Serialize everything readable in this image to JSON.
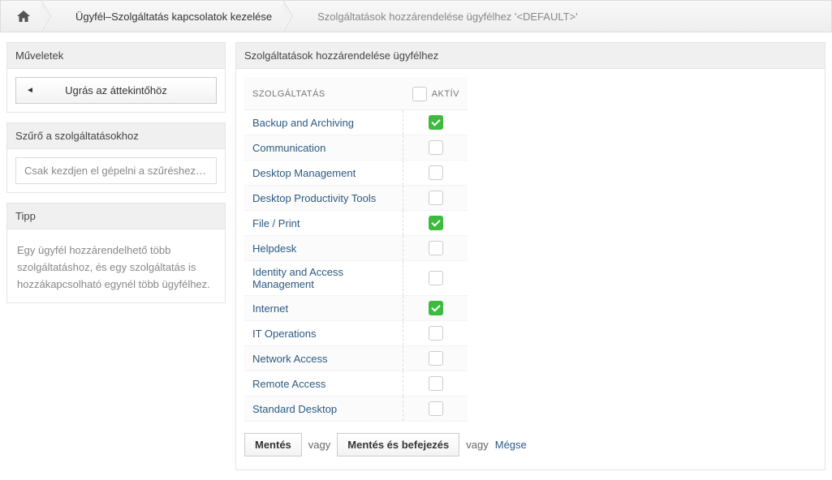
{
  "breadcrumb": {
    "main": "Ügyfél–Szolgáltatás kapcsolatok kezelése",
    "sub": "Szolgáltatások hozzárendelése ügyfélhez '<DEFAULT>'"
  },
  "sidebar": {
    "actions": {
      "title": "Műveletek",
      "back_label": "Ugrás az áttekintőhöz"
    },
    "filter": {
      "title": "Szűrő a szolgáltatásokhoz",
      "placeholder": "Csak kezdjen el gépelni a szűréshez…"
    },
    "tip": {
      "title": "Tipp",
      "text": "Egy ügyfél hozzárendelhető több szolgáltatáshoz, és egy szolgáltatás is hozzákapcsolható egynél több ügyfélhez."
    }
  },
  "main": {
    "title": "Szolgáltatások hozzárendelése ügyfélhez",
    "columns": {
      "service": "SZOLGÁLTATÁS",
      "active": "AKTÍV"
    },
    "services": [
      {
        "name": "Backup and Archiving",
        "active": true
      },
      {
        "name": "Communication",
        "active": false
      },
      {
        "name": "Desktop Management",
        "active": false
      },
      {
        "name": "Desktop Productivity Tools",
        "active": false
      },
      {
        "name": "File / Print",
        "active": true
      },
      {
        "name": "Helpdesk",
        "active": false
      },
      {
        "name": "Identity and Access Management",
        "active": false
      },
      {
        "name": "Internet",
        "active": true
      },
      {
        "name": "IT Operations",
        "active": false
      },
      {
        "name": "Network Access",
        "active": false
      },
      {
        "name": "Remote Access",
        "active": false
      },
      {
        "name": "Standard Desktop",
        "active": false
      }
    ],
    "actions": {
      "save": "Mentés",
      "or1": "vagy",
      "save_finish": "Mentés és befejezés",
      "or2": "vagy",
      "cancel": "Mégse"
    }
  }
}
